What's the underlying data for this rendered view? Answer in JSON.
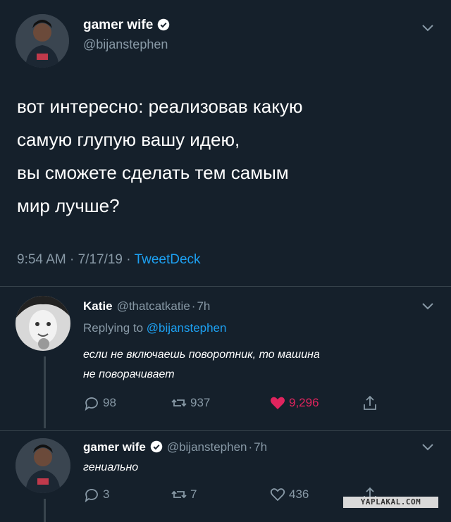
{
  "main_tweet": {
    "display_name": "gamer wife",
    "handle": "@bijanstephen",
    "text_lines": [
      "вот интересно: реализовав какую",
      "самую глупую вашу идею,",
      "вы сможете сделать тем самым",
      "мир лучше?"
    ],
    "time": "9:54 AM",
    "date": "7/17/19",
    "source": "TweetDeck",
    "separator": "·",
    "avatar_icon": "person-avatar-icon",
    "verified_icon": "verified-badge-icon"
  },
  "reply_1": {
    "display_name": "Katie",
    "handle": "@thatcatkatie",
    "age": "7h",
    "replying_to_label": "Replying to",
    "replying_to_handle": "@bijanstephen",
    "text_lines": [
      "если не включаешь поворотник, то машина",
      "не поворачивает"
    ],
    "replies": "98",
    "retweets": "937",
    "likes": "9,296",
    "liked": true
  },
  "reply_2": {
    "display_name": "gamer wife",
    "handle": "@bijanstephen",
    "age": "7h",
    "text": "гениально",
    "replies": "3",
    "retweets": "7",
    "likes": "436"
  },
  "watermark": "YAPLAKAL.COM",
  "colors": {
    "background": "#15202b",
    "muted": "#8899a6",
    "link": "#1da1f2",
    "like": "#e0245e",
    "divider": "#38444d"
  }
}
